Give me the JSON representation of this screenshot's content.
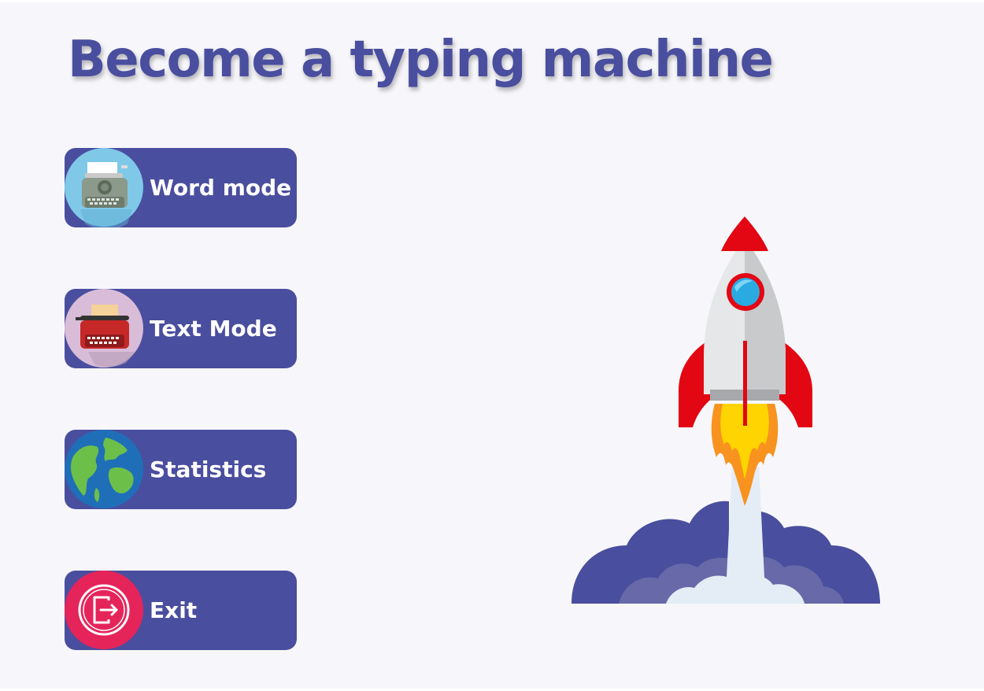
{
  "header": {
    "title": "Become a typing machine"
  },
  "menu": {
    "items": [
      {
        "id": "word",
        "label": "Word mode",
        "icon": "typewriter-icon"
      },
      {
        "id": "text",
        "label": "Text Mode",
        "icon": "red-typewriter-icon"
      },
      {
        "id": "stats",
        "label": "Statistics",
        "icon": "globe-icon"
      },
      {
        "id": "exit",
        "label": "Exit",
        "icon": "exit-door-icon"
      }
    ]
  },
  "illustration": {
    "name": "rocket-launch-illustration"
  },
  "colors": {
    "background": "#f7f7fb",
    "accent": "#4a4e9e",
    "title": "#4a4e9e",
    "button_text": "#ffffff",
    "rocket_red": "#e30613",
    "flame_yellow": "#ffd400",
    "flame_orange": "#f7931e"
  }
}
